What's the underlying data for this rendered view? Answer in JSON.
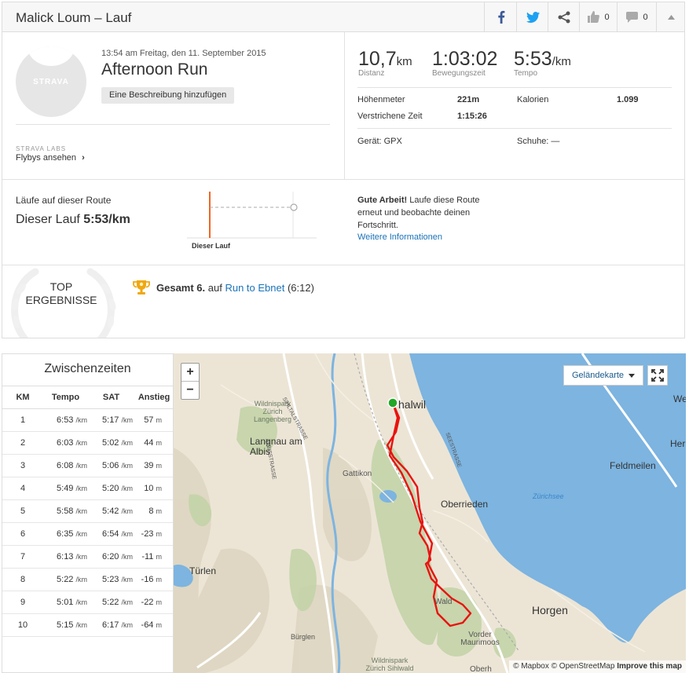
{
  "header": {
    "title": "Malick Loum – Lauf",
    "kudos_count": "0",
    "comments_count": "0"
  },
  "activity": {
    "avatar_brand": "STRAVA",
    "date": "13:54 am Freitag, den 11. September 2015",
    "title": "Afternoon Run",
    "add_description": "Eine Beschreibung hinzufügen",
    "labs_label": "STRAVA LABS",
    "flybys_link": "Flybys ansehen",
    "flybys_chevron": "›"
  },
  "stats": {
    "distance": {
      "value": "10,7",
      "unit": "km",
      "label": "Distanz"
    },
    "moving_time": {
      "value": "1:03:02",
      "label": "Bewegungszeit"
    },
    "pace": {
      "value": "5:53",
      "unit": "/km",
      "label": "Tempo"
    },
    "elevation_label": "Höhenmeter",
    "elevation_value": "221m",
    "calories_label": "Kalorien",
    "calories_value": "1.099",
    "elapsed_label": "Verstrichene Zeit",
    "elapsed_value": "1:15:26",
    "device": "Gerät: GPX",
    "shoes": "Schuhe: —"
  },
  "route": {
    "heading": "Läufe auf dieser Route",
    "this_run_label": "Dieser Lauf",
    "this_run_pace": "5:53/km",
    "chart_label": "Dieser Lauf",
    "good_bold": "Gute Arbeit!",
    "good_text": " Laufe diese Route erneut und beobachte deinen Fortschritt.",
    "more_info": "Weitere Informationen"
  },
  "top_results": {
    "label_line1": "TOP",
    "label_line2": "ERGEBNISSE",
    "result_bold": "Gesamt 6.",
    "result_mid": " auf ",
    "segment_name": "Run to Ebnet",
    "result_time": " (6:12)"
  },
  "splits": {
    "title": "Zwischenzeiten",
    "columns": [
      "KM",
      "Tempo",
      "SAT",
      "Anstieg"
    ],
    "pace_unit": "/km",
    "elev_unit": "m",
    "rows": [
      {
        "km": "1",
        "pace": "6:53",
        "gap": "5:17",
        "elev": "57"
      },
      {
        "km": "2",
        "pace": "6:03",
        "gap": "5:02",
        "elev": "44"
      },
      {
        "km": "3",
        "pace": "6:08",
        "gap": "5:06",
        "elev": "39"
      },
      {
        "km": "4",
        "pace": "5:49",
        "gap": "5:20",
        "elev": "10"
      },
      {
        "km": "5",
        "pace": "5:58",
        "gap": "5:42",
        "elev": "8"
      },
      {
        "km": "6",
        "pace": "6:35",
        "gap": "6:54",
        "elev": "-23"
      },
      {
        "km": "7",
        "pace": "6:13",
        "gap": "6:20",
        "elev": "-11"
      },
      {
        "km": "8",
        "pace": "5:22",
        "gap": "5:23",
        "elev": "-16"
      },
      {
        "km": "9",
        "pace": "5:01",
        "gap": "5:22",
        "elev": "-22"
      },
      {
        "km": "10",
        "pace": "5:15",
        "gap": "6:17",
        "elev": "-64"
      }
    ]
  },
  "map": {
    "zoom_in": "+",
    "zoom_out": "−",
    "map_type": "Geländekarte",
    "attribution_mapbox": "© Mapbox",
    "attribution_osm": "© OpenStreetMap",
    "attribution_improve": "Improve this map",
    "labels": {
      "thalwil": "halwil",
      "oberrieden": "Oberrieden",
      "feldmeilen": "Feldmeilen",
      "horgen": "Horgen",
      "zurichsee": "Zürichsee",
      "langnau": "Langnau am Albis",
      "gattikon": "Gattikon",
      "wildnispark_top": "Wildnispark Zürich Langenberg",
      "wildnispark_bottom": "Wildnispark Zürich Sihlwald",
      "turlen": "Türlen",
      "burglen": "Bürglen",
      "vorder": "Vorder Maurimoos",
      "wald": "Wald",
      "obe": "Oberh",
      "we": "We",
      "her": "Her",
      "sihltalstrasse": "SIHLTALSTRASSE",
      "seestrasse": "SEESTRASSE",
      "albisstrasse": "ALBISSTRASSE"
    },
    "colors": {
      "water": "#7db4e0",
      "route": "#e8130f",
      "start": "#22a727"
    }
  }
}
